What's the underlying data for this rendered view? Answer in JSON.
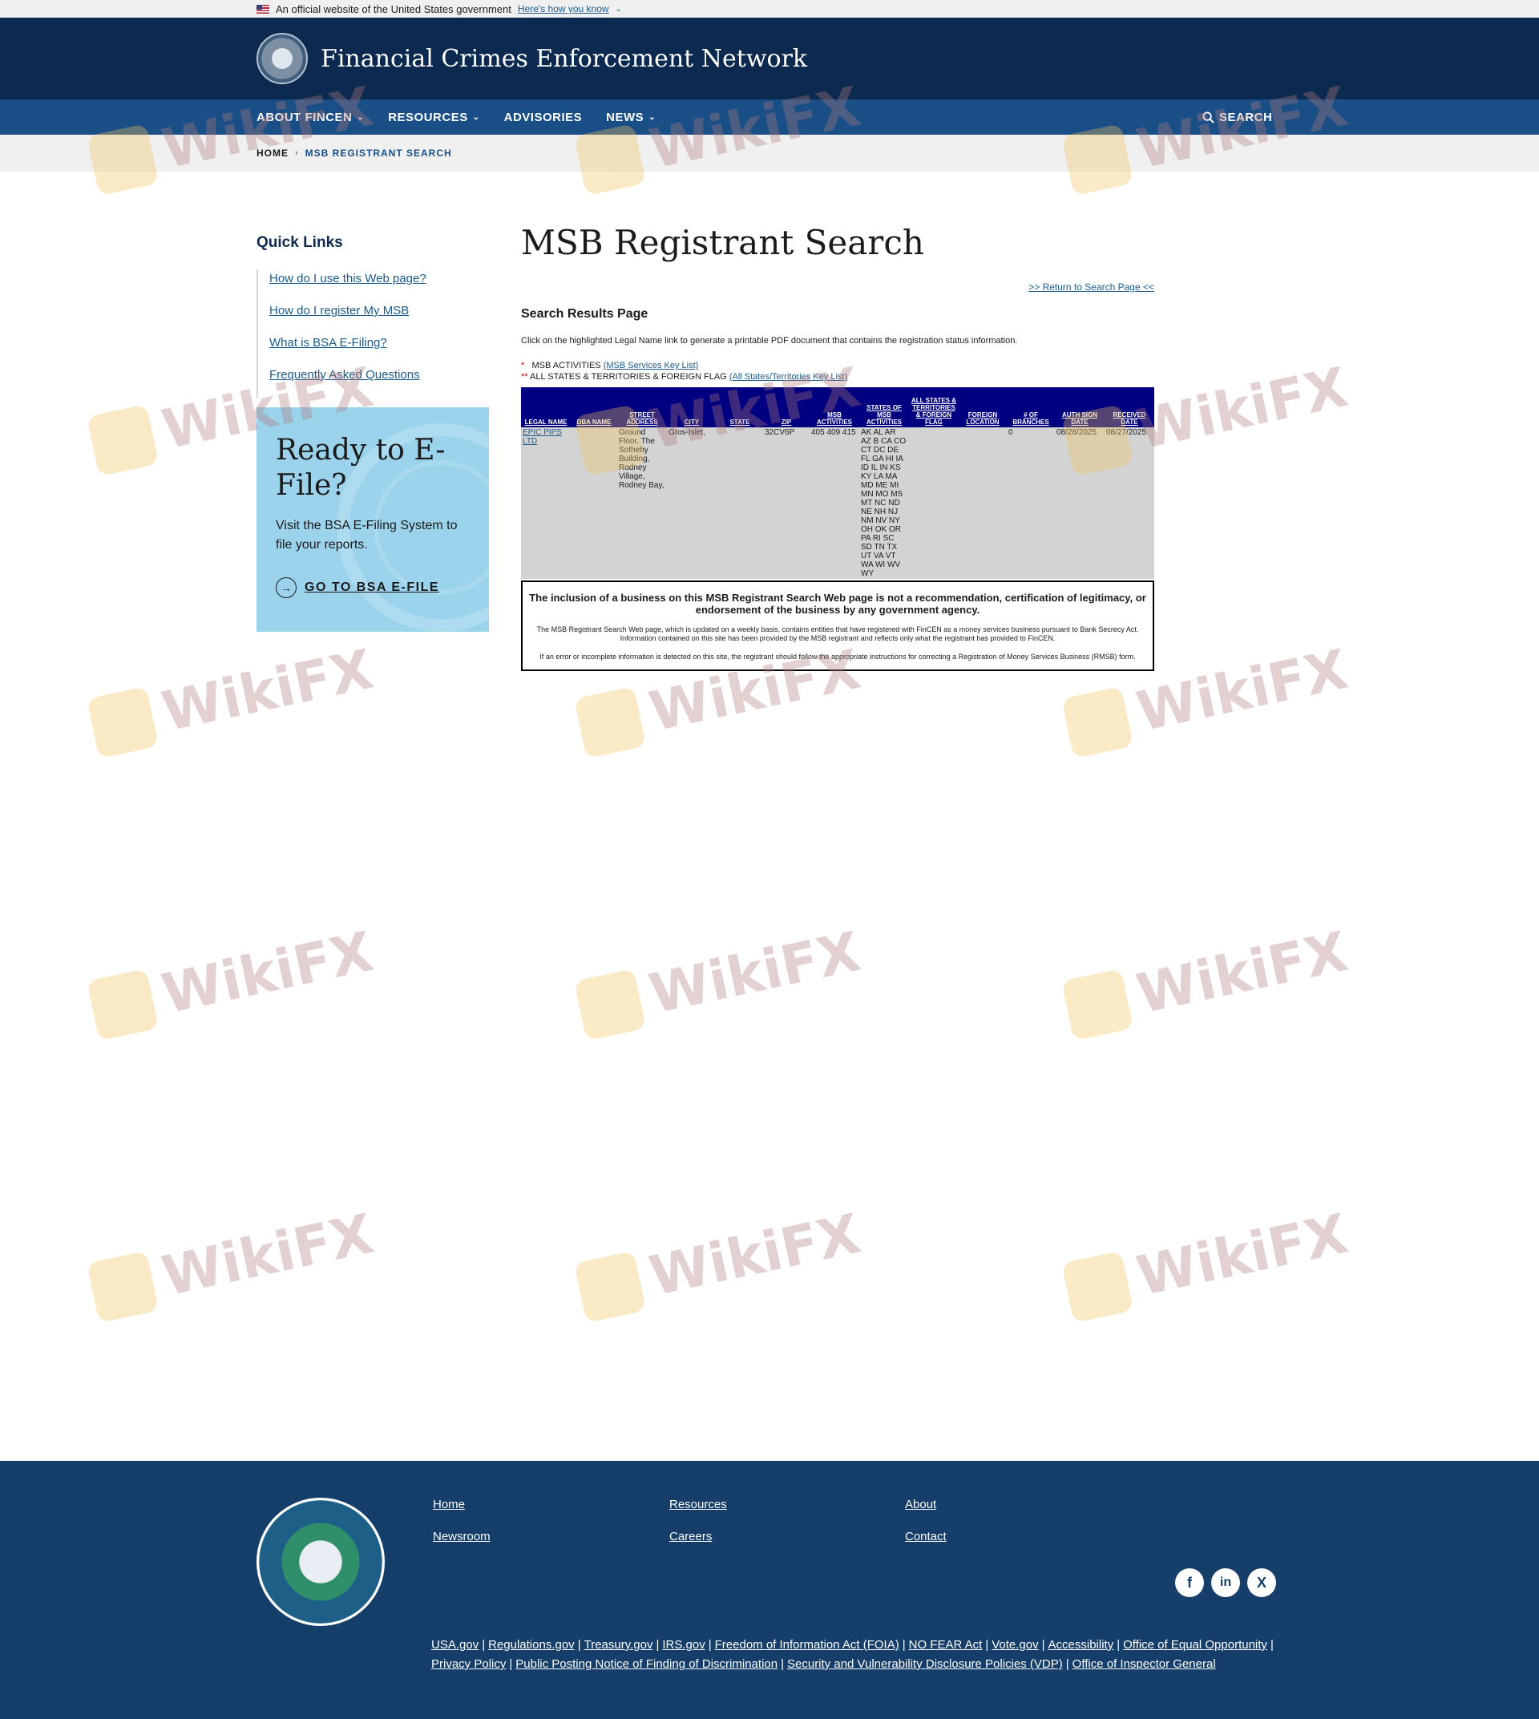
{
  "gov_banner": {
    "text": "An official website of the United States government",
    "know_link": "Here's how you know"
  },
  "header": {
    "site_title": "Financial Crimes Enforcement Network"
  },
  "nav": {
    "items": [
      {
        "label": "ABOUT FINCEN",
        "has_dropdown": true
      },
      {
        "label": "RESOURCES",
        "has_dropdown": true
      },
      {
        "label": "ADVISORIES",
        "has_dropdown": false
      },
      {
        "label": "NEWS",
        "has_dropdown": true
      }
    ],
    "search_label": "SEARCH"
  },
  "breadcrumb": {
    "home": "HOME",
    "current": "MSB REGISTRANT SEARCH"
  },
  "sidebar": {
    "title": "Quick Links",
    "links": [
      "How do I use this Web page?",
      "How do I register My MSB",
      "What is BSA E-Filing?",
      "Frequently Asked Questions"
    ],
    "efile": {
      "title": "Ready to E-File?",
      "text": "Visit the BSA E-Filing System to file your reports.",
      "cta": "GO TO BSA E-FILE"
    }
  },
  "main": {
    "title": "MSB Registrant Search",
    "return_link": ">> Return to Search Page <<",
    "results_title": "Search Results Page",
    "results_desc": "Click on the highlighted Legal Name link to generate a printable PDF document that contains the registration status information.",
    "key1": {
      "star": "*",
      "label": "MSB ACTIVITIES",
      "link": "(MSB Services Key List)"
    },
    "key2": {
      "star": "**",
      "label": "ALL STATES & TERRITORIES & FOREIGN FLAG",
      "link": "(All States/Territories Key List)"
    },
    "table": {
      "headers": [
        "LEGAL NAME",
        "DBA NAME",
        "STREET ADDRESS",
        "CITY",
        "STATE",
        "ZIP",
        "MSB ACTIVITIES",
        "STATES OF MSB ACTIVITIES",
        "ALL STATES & TERRITORIES & FOREIGN FLAG",
        "FOREIGN LOCATION",
        "# OF BRANCHES",
        "AUTH SIGN DATE",
        "RECEIVED DATE"
      ],
      "row": {
        "legal_name": "EPIC PIPS LTD",
        "dba_name": "",
        "street": "Ground Floor, The Sotheby Building, Rodney Village, Rodney Bay,",
        "city": "Gros-Islet,",
        "state": "",
        "zip": "32CV6P",
        "activities": "405 409 415",
        "states": "AK AL AR AZ B CA CO CT DC DE FL GA HI IA ID IL IN KS KY LA MA MD ME MI MN MO MS MT NC ND NE NH NJ NM NV NY OH OK OR PA RI SC SD TN TX UT VA VT WA WI WV WY",
        "all_states_flag": "",
        "foreign_location": "",
        "branches": "0",
        "auth_sign_date": "08/28/2025",
        "received_date": "08/27/2025"
      }
    },
    "disclaimer": {
      "main": "The inclusion of a business on this MSB Registrant Search Web page is not a recommendation, certification of legitimacy, or endorsement of the business by any government agency.",
      "p1": "The MSB Registrant Search Web page, which is updated on a weekly basis, contains entities that have registered with FinCEN as a money services business pursuant to Bank Secrecy Act. Information contained on this site has been provided by the MSB registrant and reflects only what the registrant has provided to FinCEN.",
      "p2": "If an error or incomplete information is detected on this site, the registrant should follow the appropriate instructions for correcting a Registration of Money Services Business (RMSB) form."
    }
  },
  "footer": {
    "col_links": {
      "home": "Home",
      "newsroom": "Newsroom",
      "resources": "Resources",
      "careers": "Careers",
      "about": "About",
      "contact": "Contact"
    },
    "social": {
      "facebook": "f",
      "linkedin": "in",
      "x": "X"
    },
    "bottom_links": [
      "USA.gov",
      "Regulations.gov",
      "Treasury.gov",
      "IRS.gov",
      "Freedom of Information Act (FOIA)",
      "NO FEAR Act",
      "Vote.gov",
      "Accessibility",
      "Office of Equal Opportunity",
      "Privacy Policy",
      "Public Posting Notice of Finding of Discrimination",
      "Security and Vulnerability Disclosure Policies (VDP)",
      "Office of Inspector General"
    ]
  },
  "watermark": {
    "text": "WikiFX"
  }
}
